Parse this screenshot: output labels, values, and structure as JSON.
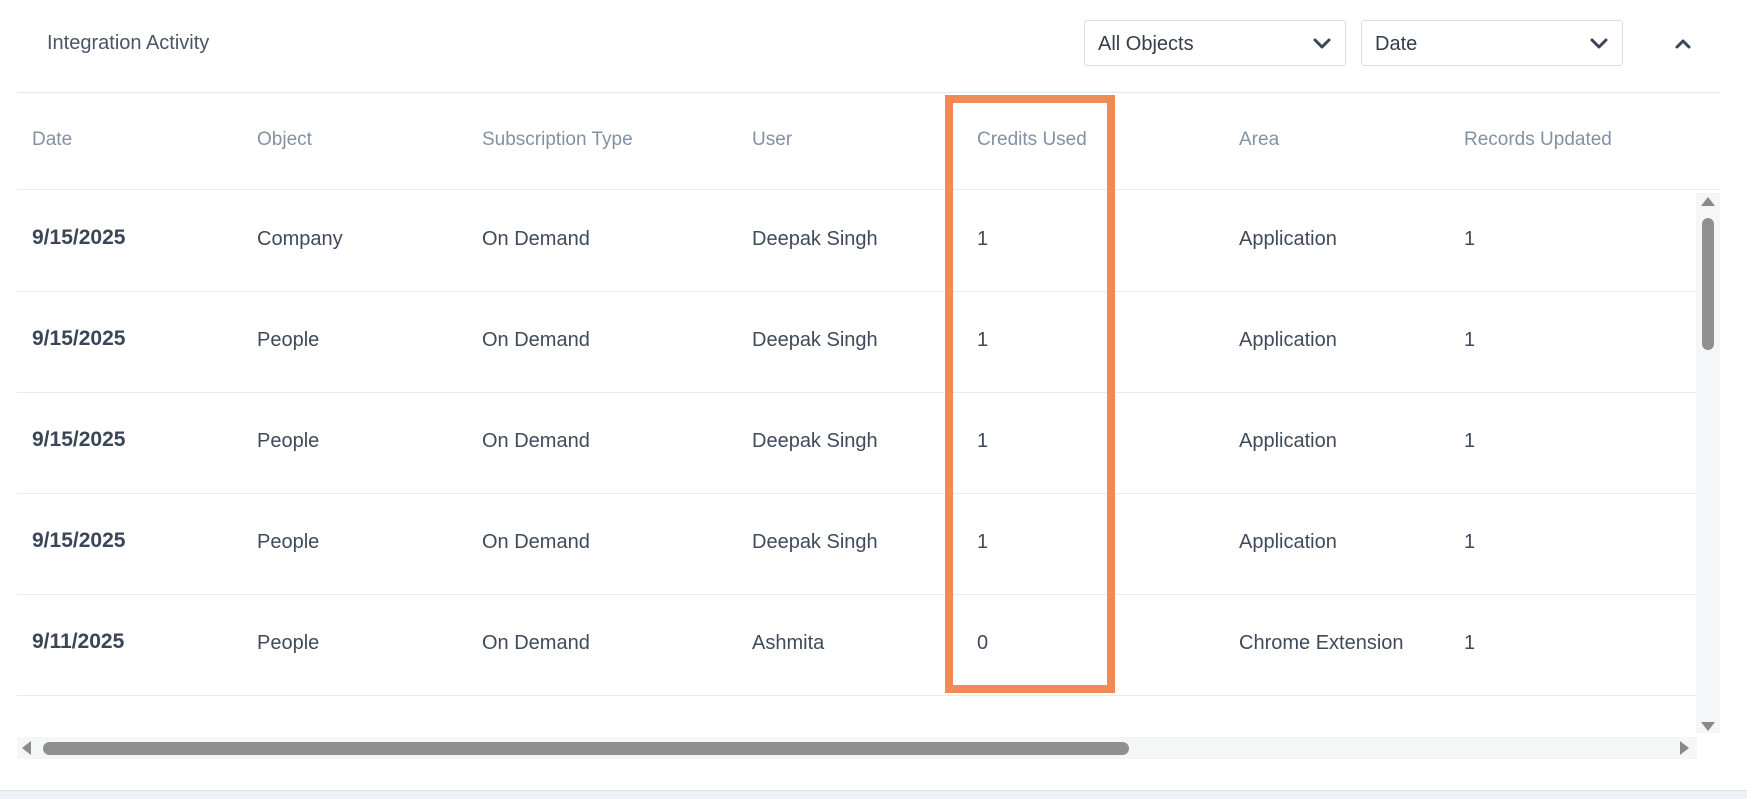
{
  "header": {
    "title": "Integration Activity",
    "object_filter": {
      "selected": "All Objects",
      "icon": "chevron-down-icon"
    },
    "sort_filter": {
      "selected": "Date",
      "icon": "chevron-down-icon"
    },
    "collapse_icon": "chevron-up-icon"
  },
  "table": {
    "columns": [
      "Date",
      "Object",
      "Subscription Type",
      "User",
      "Credits Used",
      "Area",
      "Records Updated"
    ],
    "rows": [
      [
        "9/15/2025",
        "Company",
        "On Demand",
        "Deepak Singh",
        "1",
        "Application",
        "1"
      ],
      [
        "9/15/2025",
        "People",
        "On Demand",
        "Deepak Singh",
        "1",
        "Application",
        "1"
      ],
      [
        "9/15/2025",
        "People",
        "On Demand",
        "Deepak Singh",
        "1",
        "Application",
        "1"
      ],
      [
        "9/15/2025",
        "People",
        "On Demand",
        "Deepak Singh",
        "1",
        "Application",
        "1"
      ],
      [
        "9/11/2025",
        "People",
        "On Demand",
        "Ashmita",
        "0",
        "Chrome Extension",
        "1"
      ]
    ],
    "highlighted_column": "Credits Used"
  },
  "colors": {
    "highlight_border": "#f28a55",
    "header_text": "#8391a5",
    "body_text": "#3f4a5a"
  }
}
